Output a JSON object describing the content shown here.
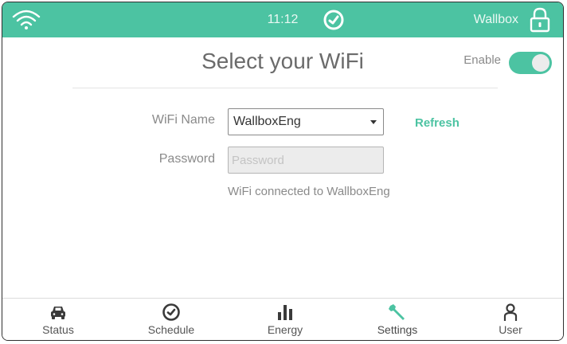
{
  "header": {
    "time": "11:12",
    "device_name": "Wallbox",
    "icons": [
      "wifi-icon",
      "clock-icon",
      "lock-icon"
    ]
  },
  "page": {
    "title": "Select your WiFi",
    "enable_label": "Enable",
    "enable_on": true
  },
  "form": {
    "wifi_name_label": "WiFi Name",
    "wifi_selected": "WallboxEng",
    "refresh_label": "Refresh",
    "password_label": "Password",
    "password_placeholder": "Password",
    "password_value": "",
    "status_text": "WiFi connected to WallboxEng"
  },
  "nav": {
    "items": [
      {
        "label": "Status",
        "icon": "car-icon"
      },
      {
        "label": "Schedule",
        "icon": "clock-icon"
      },
      {
        "label": "Energy",
        "icon": "bar-chart-icon"
      },
      {
        "label": "Settings",
        "icon": "wrench-icon",
        "active": true
      },
      {
        "label": "User",
        "icon": "user-icon"
      }
    ]
  },
  "colors": {
    "accent": "#4cc3a2",
    "text_muted": "#8a8a8a"
  }
}
